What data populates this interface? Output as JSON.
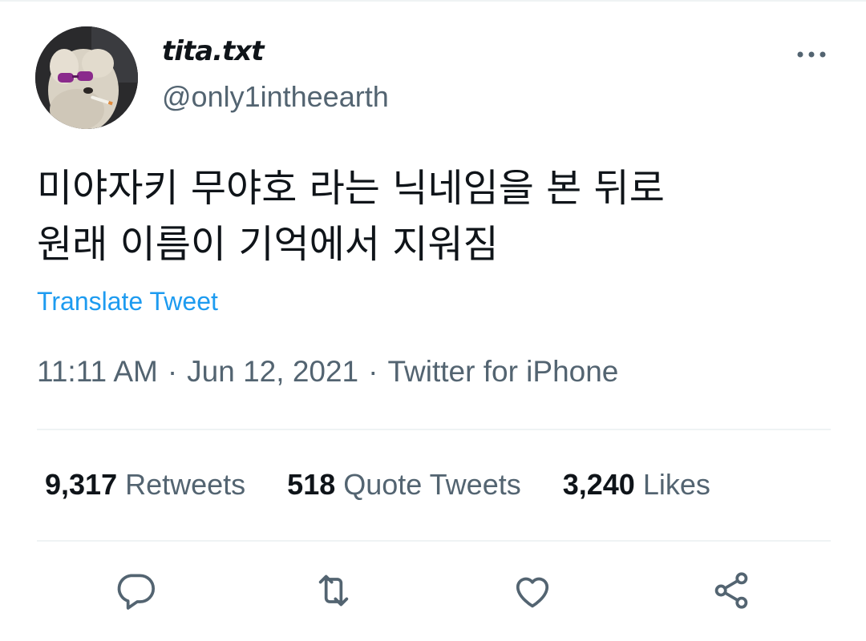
{
  "user": {
    "display_name": "tita.txt",
    "handle": "@only1intheearth",
    "avatar": "avatar-dog-sunglasses"
  },
  "header": {
    "more_icon": "more-horizontal-icon"
  },
  "tweet": {
    "lines": [
      "미야자키 무야호 라는 닉네임을 본 뒤로",
      "원래 이름이 기억에서 지워짐"
    ],
    "translate_label": "Translate Tweet"
  },
  "meta": {
    "time": "11:11 AM",
    "separator": "·",
    "date": "Jun 12, 2021",
    "source": "Twitter for iPhone"
  },
  "stats": {
    "retweets": {
      "count": "9,317",
      "label": "Retweets"
    },
    "quotes": {
      "count": "518",
      "label": "Quote Tweets"
    },
    "likes": {
      "count": "3,240",
      "label": "Likes"
    }
  },
  "actions": [
    {
      "icon": "reply-icon"
    },
    {
      "icon": "retweet-icon"
    },
    {
      "icon": "like-icon"
    },
    {
      "icon": "share-icon"
    }
  ],
  "colors": {
    "text": "#0f1419",
    "secondary": "#536471",
    "link": "#1d9bf0",
    "divider": "#eff3f4"
  }
}
